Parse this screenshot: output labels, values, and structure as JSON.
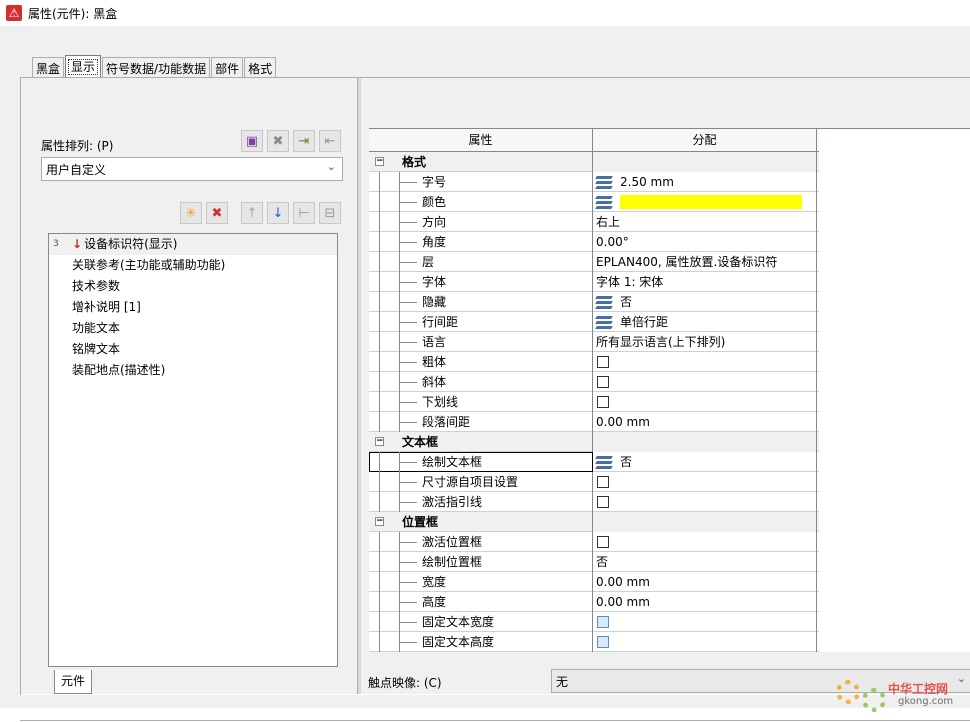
{
  "window": {
    "title": "属性(元件): 黑盒"
  },
  "tabs": [
    {
      "label": "黑盒"
    },
    {
      "label": "显示"
    },
    {
      "label": "符号数据/功能数据"
    },
    {
      "label": "部件"
    },
    {
      "label": "格式"
    }
  ],
  "left": {
    "sort_label": "属性排列: (P)",
    "sort_value": "用户自定义",
    "list_badge": "3",
    "list": [
      "设备标识符(显示)",
      "关联参考(主功能或辅助功能)",
      "技术参数",
      "增补说明 [1]",
      "功能文本",
      "铭牌文本",
      "装配地点(描述性)"
    ],
    "bottom_tab": "元件"
  },
  "grid": {
    "header": [
      "属性",
      "分配"
    ],
    "groups": [
      {
        "name": "格式",
        "rows": [
          {
            "label": "字号",
            "value": "2.50 mm",
            "icon": "stack-icon"
          },
          {
            "label": "颜色",
            "value": "",
            "icon": "stack-icon",
            "color": "#ffff00"
          },
          {
            "label": "方向",
            "value": "右上"
          },
          {
            "label": "角度",
            "value": "0.00°"
          },
          {
            "label": "层",
            "value": "EPLAN400, 属性放置.设备标识符"
          },
          {
            "label": "字体",
            "value": "字体 1: 宋体"
          },
          {
            "label": "隐藏",
            "value": "否",
            "icon": "stack-icon"
          },
          {
            "label": "行间距",
            "value": "单倍行距",
            "icon": "stack-icon"
          },
          {
            "label": "语言",
            "value": "所有显示语言(上下排列)"
          },
          {
            "label": "粗体",
            "checkbox": false
          },
          {
            "label": "斜体",
            "checkbox": false
          },
          {
            "label": "下划线",
            "checkbox": false
          },
          {
            "label": "段落间距",
            "value": "0.00 mm"
          }
        ]
      },
      {
        "name": "文本框",
        "rows": [
          {
            "label": "绘制文本框",
            "value": "否",
            "icon": "stack-icon",
            "focused": true
          },
          {
            "label": "尺寸源自项目设置",
            "checkbox": false
          },
          {
            "label": "激活指引线",
            "checkbox": false
          }
        ]
      },
      {
        "name": "位置框",
        "rows": [
          {
            "label": "激活位置框",
            "checkbox": false
          },
          {
            "label": "绘制位置框",
            "value": "否"
          },
          {
            "label": "宽度",
            "value": "0.00 mm"
          },
          {
            "label": "高度",
            "value": "0.00 mm"
          },
          {
            "label": "固定文本宽度",
            "checkbox": false,
            "blue": true
          },
          {
            "label": "固定文本高度",
            "checkbox": false,
            "blue": true
          }
        ]
      }
    ]
  },
  "touch": {
    "label": "触点映像: (C)",
    "value": "无"
  },
  "watermark": {
    "text": "中华工控网",
    "url": "gkong.com"
  }
}
